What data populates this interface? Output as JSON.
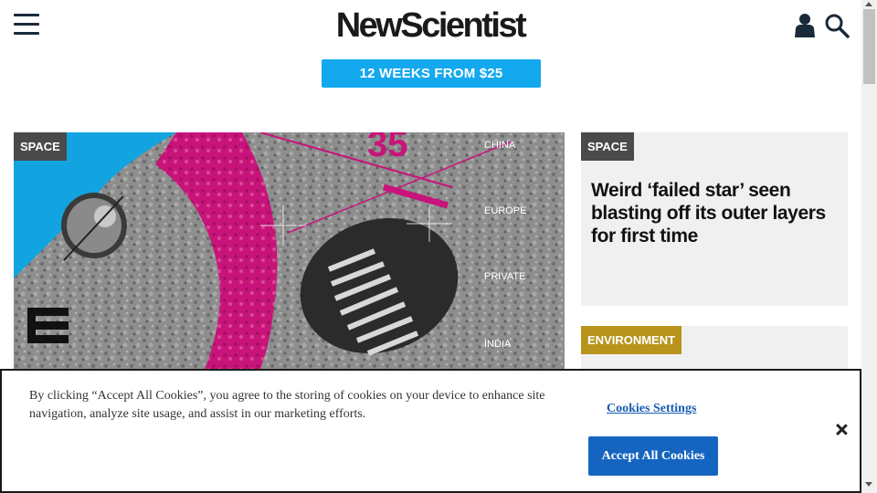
{
  "header": {
    "logo": "NewScientist",
    "menu_icon": "hamburger-menu-icon",
    "account_icon": "user-account-icon",
    "search_icon": "search-icon"
  },
  "promo": {
    "label": "12 WEEKS FROM $25",
    "color": "#14a8ee"
  },
  "hero": {
    "tag": "SPACE",
    "image_labels": [
      "CHINA",
      "EUROPE",
      "PRIVATE",
      "INDIA"
    ],
    "image_number": "35",
    "accent_color": "#c8147a",
    "sky_color": "#12a4e0"
  },
  "cards": [
    {
      "tag": "SPACE",
      "headline": "Weird ‘failed star’ seen blasting off its outer layers for first time"
    },
    {
      "tag": "ENVIRONMENT",
      "tag_color": "#b8941d"
    }
  ],
  "cookie_banner": {
    "text": "By clicking “Accept All Cookies”, you agree to the storing of cookies on your device to enhance site navigation, analyze site usage, and assist in our marketing efforts.",
    "settings_label": "Cookies Settings",
    "accept_label": "Accept All Cookies",
    "close_icon": "close-icon",
    "accept_color": "#1565c0"
  }
}
